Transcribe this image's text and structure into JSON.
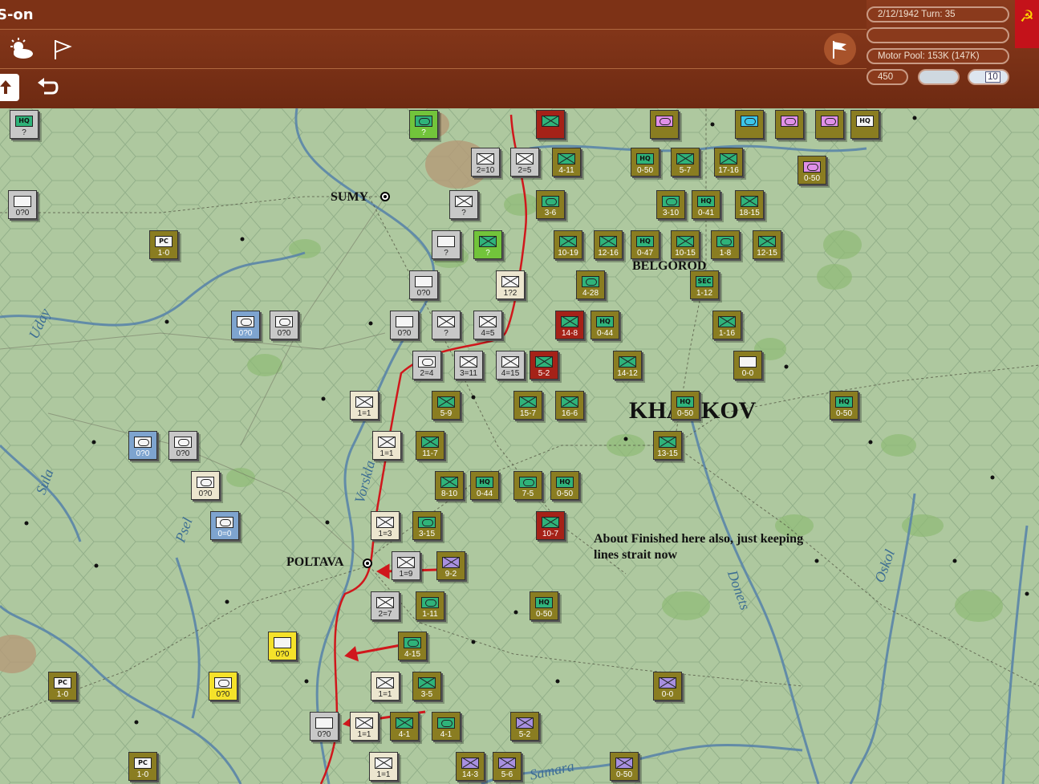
{
  "app": {
    "title": "S-on"
  },
  "toolbar": {
    "weather_icon": "weather-sun-cloud-icon",
    "flag_icon": "flag-outline-icon",
    "upload_icon": "upload-icon",
    "undo_icon": "undo-icon",
    "nation_flag_icon": "flag-icon"
  },
  "status": {
    "date_turn": "2/12/1942  Turn: 35",
    "empty_line": "",
    "motor_pool": "Motor Pool: 153K (147K)",
    "points": "450",
    "weather_text": "",
    "turn_badge": "10"
  },
  "map": {
    "cities": [
      {
        "name": "SUMY"
      },
      {
        "name": "BELGOROD"
      },
      {
        "name": "KHARKOV"
      },
      {
        "name": "POLTAVA"
      }
    ],
    "rivers": [
      "Uday",
      "Sula",
      "Psel",
      "Vorskla",
      "Donets",
      "Oskol",
      "Samara"
    ],
    "annotation": [
      "About Finished here also, just keeping",
      "lines strait now"
    ],
    "counters": [
      {
        "label": "?",
        "color": "grey",
        "type": "hq"
      },
      {
        "label": "0?0",
        "color": "grey",
        "type": "wht"
      },
      {
        "label": "1-0",
        "color": "olive",
        "type": "pc"
      },
      {
        "label": "?",
        "color": "green",
        "type": "oval"
      },
      {
        "label": "2=10",
        "color": "grey",
        "type": "x"
      },
      {
        "label": "2=5",
        "color": "grey",
        "type": "x"
      },
      {
        "label": "4-11",
        "color": "olive",
        "type": "x"
      },
      {
        "label": "?",
        "color": "grey",
        "type": "x"
      },
      {
        "label": "3-6",
        "color": "olive",
        "type": "oval"
      },
      {
        "label": "?",
        "color": "grey",
        "type": "wht"
      },
      {
        "label": "?",
        "color": "green",
        "type": "x"
      },
      {
        "label": "0?0",
        "color": "grey",
        "type": "wht"
      },
      {
        "label": "1?2",
        "color": "white",
        "type": "x"
      },
      {
        "label": "0?0",
        "color": "grey",
        "type": "wht"
      },
      {
        "label": "?",
        "color": "grey",
        "type": "x"
      },
      {
        "label": "4=5",
        "color": "grey",
        "type": "x"
      },
      {
        "label": "0?0",
        "color": "blue",
        "type": "oval"
      },
      {
        "label": "0?0",
        "color": "grey",
        "type": "oval"
      },
      {
        "label": "2=4",
        "color": "grey",
        "type": "oval"
      },
      {
        "label": "3=11",
        "color": "grey",
        "type": "x"
      },
      {
        "label": "4=15",
        "color": "grey",
        "type": "x"
      },
      {
        "label": "5-2",
        "color": "red",
        "type": "x"
      },
      {
        "label": "1=1",
        "color": "white",
        "type": "x"
      },
      {
        "label": "5-9",
        "color": "olive",
        "type": "x"
      },
      {
        "label": "15-7",
        "color": "olive",
        "type": "x"
      },
      {
        "label": "16-6",
        "color": "olive",
        "type": "x"
      },
      {
        "label": "0?0",
        "color": "blue",
        "type": "oval"
      },
      {
        "label": "0?0",
        "color": "grey",
        "type": "oval"
      },
      {
        "label": "1=1",
        "color": "white",
        "type": "x"
      },
      {
        "label": "11-7",
        "color": "olive",
        "type": "x"
      },
      {
        "label": "0?0",
        "color": "white",
        "type": "oval"
      },
      {
        "label": "8-10",
        "color": "olive",
        "type": "x"
      },
      {
        "label": "0-44",
        "color": "olive",
        "type": "hq"
      },
      {
        "label": "7-5",
        "color": "olive",
        "type": "oval"
      },
      {
        "label": "0-50",
        "color": "olive",
        "type": "hq"
      },
      {
        "label": "0=0",
        "color": "blue",
        "type": "oval"
      },
      {
        "label": "1=3",
        "color": "white",
        "type": "x"
      },
      {
        "label": "3-15",
        "color": "olive",
        "type": "oval"
      },
      {
        "label": "10-7",
        "color": "red",
        "type": "x"
      },
      {
        "label": "1=9",
        "color": "grey",
        "type": "x"
      },
      {
        "label": "9-2",
        "color": "olive",
        "type": "purple"
      },
      {
        "label": "2=7",
        "color": "grey",
        "type": "x"
      },
      {
        "label": "1-11",
        "color": "olive",
        "type": "oval"
      },
      {
        "label": "0-50",
        "color": "olive",
        "type": "hq"
      },
      {
        "label": "0?0",
        "color": "yellow",
        "type": "wht"
      },
      {
        "label": "4-15",
        "color": "olive",
        "type": "oval"
      },
      {
        "label": "1-0",
        "color": "olive",
        "type": "pc"
      },
      {
        "label": "0?0",
        "color": "yellow",
        "type": "oval"
      },
      {
        "label": "1=1",
        "color": "white",
        "type": "x"
      },
      {
        "label": "3-5",
        "color": "olive",
        "type": "x"
      },
      {
        "label": "0-0",
        "color": "olive",
        "type": "purple"
      },
      {
        "label": "0?0",
        "color": "grey",
        "type": "wht"
      },
      {
        "label": "1=1",
        "color": "white",
        "type": "x"
      },
      {
        "label": "4-1",
        "color": "olive",
        "type": "x"
      },
      {
        "label": "4-1",
        "color": "olive",
        "type": "oval"
      },
      {
        "label": "5-2",
        "color": "olive",
        "type": "purple"
      },
      {
        "label": "1-0",
        "color": "olive",
        "type": "pc"
      },
      {
        "label": "1=1",
        "color": "white",
        "type": "x"
      },
      {
        "label": "14-3",
        "color": "olive",
        "type": "purple"
      },
      {
        "label": "5-6",
        "color": "olive",
        "type": "purple"
      },
      {
        "label": "0-50",
        "color": "olive",
        "type": "purple"
      },
      {
        "label": "",
        "color": "red",
        "type": "x"
      },
      {
        "label": "",
        "color": "olive",
        "type": "pink"
      },
      {
        "label": "",
        "color": "olive",
        "type": "cyan"
      },
      {
        "label": "",
        "color": "olive",
        "type": "pink"
      },
      {
        "label": "",
        "color": "olive",
        "type": "pink"
      },
      {
        "label": "",
        "color": "olive",
        "type": "hqtxt"
      },
      {
        "label": "0-50",
        "color": "olive",
        "type": "hq"
      },
      {
        "label": "5-7",
        "color": "olive",
        "type": "x"
      },
      {
        "label": "17-16",
        "color": "olive",
        "type": "x"
      },
      {
        "label": "0-50",
        "color": "olive",
        "type": "pink"
      },
      {
        "label": "3-10",
        "color": "olive",
        "type": "oval"
      },
      {
        "label": "0-41",
        "color": "olive",
        "type": "hq"
      },
      {
        "label": "18-15",
        "color": "olive",
        "type": "x"
      },
      {
        "label": "10-19",
        "color": "olive",
        "type": "x"
      },
      {
        "label": "12-16",
        "color": "olive",
        "type": "x"
      },
      {
        "label": "0-47",
        "color": "olive",
        "type": "hq"
      },
      {
        "label": "10-15",
        "color": "olive",
        "type": "x"
      },
      {
        "label": "1-8",
        "color": "olive",
        "type": "oval"
      },
      {
        "label": "12-15",
        "color": "olive",
        "type": "x"
      },
      {
        "label": "4-28",
        "color": "olive",
        "type": "oval"
      },
      {
        "label": "1-12",
        "color": "olive",
        "type": "sec"
      },
      {
        "label": "14-8",
        "color": "red",
        "type": "x"
      },
      {
        "label": "0-44",
        "color": "olive",
        "type": "hq"
      },
      {
        "label": "1-16",
        "color": "olive",
        "type": "x"
      },
      {
        "label": "14-12",
        "color": "olive",
        "type": "x"
      },
      {
        "label": "0-0",
        "color": "olive",
        "type": "wht"
      },
      {
        "label": "0-50",
        "color": "olive",
        "type": "hq"
      },
      {
        "label": "0-50",
        "color": "olive",
        "type": "hq"
      },
      {
        "label": "13-15",
        "color": "olive",
        "type": "x"
      }
    ]
  }
}
